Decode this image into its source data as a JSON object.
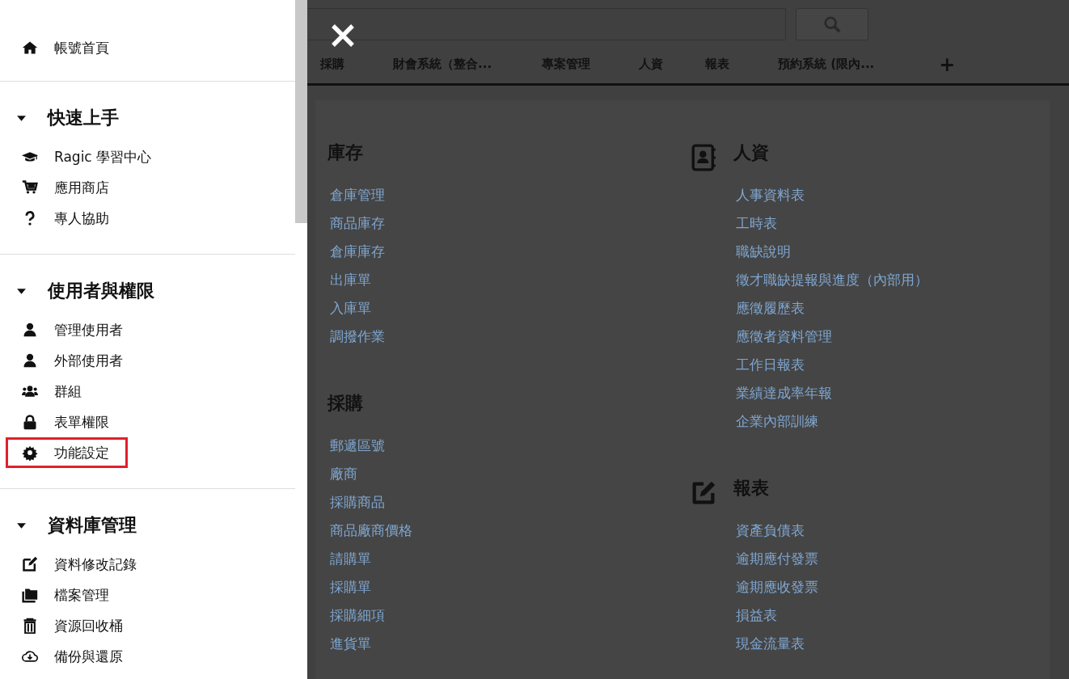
{
  "sidebar": {
    "home": {
      "label": "帳號首頁"
    },
    "sections": [
      {
        "title": "快速上手",
        "expanded": true,
        "items": [
          {
            "label": "Ragic 學習中心",
            "highlighted": false
          },
          {
            "label": "應用商店",
            "highlighted": false
          },
          {
            "label": "專人協助",
            "highlighted": false
          }
        ]
      },
      {
        "title": "使用者與權限",
        "expanded": true,
        "items": [
          {
            "label": "管理使用者",
            "highlighted": false
          },
          {
            "label": "外部使用者",
            "highlighted": false
          },
          {
            "label": "群組",
            "highlighted": false
          },
          {
            "label": "表單權限",
            "highlighted": false
          },
          {
            "label": "功能設定",
            "highlighted": true
          }
        ]
      },
      {
        "title": "資料庫管理",
        "expanded": true,
        "items": [
          {
            "label": "資料修改記錄",
            "highlighted": false
          },
          {
            "label": "檔案管理",
            "highlighted": false
          },
          {
            "label": "資源回收桶",
            "highlighted": false
          },
          {
            "label": "備份與還原",
            "highlighted": false
          }
        ]
      }
    ]
  },
  "tabs": [
    {
      "label": "採購"
    },
    {
      "label": "財會系統（整合..."
    },
    {
      "label": "專案管理"
    },
    {
      "label": "人資"
    },
    {
      "label": "報表"
    },
    {
      "label": "預約系統 (限內..."
    }
  ],
  "add_tab": "+",
  "columns": [
    [
      {
        "title": "庫存",
        "links": [
          "倉庫管理",
          "商品庫存",
          "倉庫庫存",
          "出庫單",
          "入庫單",
          "調撥作業"
        ]
      },
      {
        "title": "採購",
        "links": [
          "郵遞區號",
          "廠商",
          "採購商品",
          "商品廠商價格",
          "請購單",
          "採購單",
          "採購細項",
          "進貨單"
        ]
      }
    ],
    [
      {
        "title": "人資",
        "links": [
          "人事資料表",
          "工時表",
          "職缺說明",
          "徵才職缺提報與進度（內部用）",
          "應徵履歷表",
          "應徵者資料管理",
          "工作日報表",
          "業績達成率年報",
          "企業內部訓練"
        ]
      },
      {
        "title": "報表",
        "links": [
          "資產負債表",
          "逾期應付發票",
          "逾期應收發票",
          "損益表",
          "現金流量表"
        ]
      }
    ]
  ]
}
